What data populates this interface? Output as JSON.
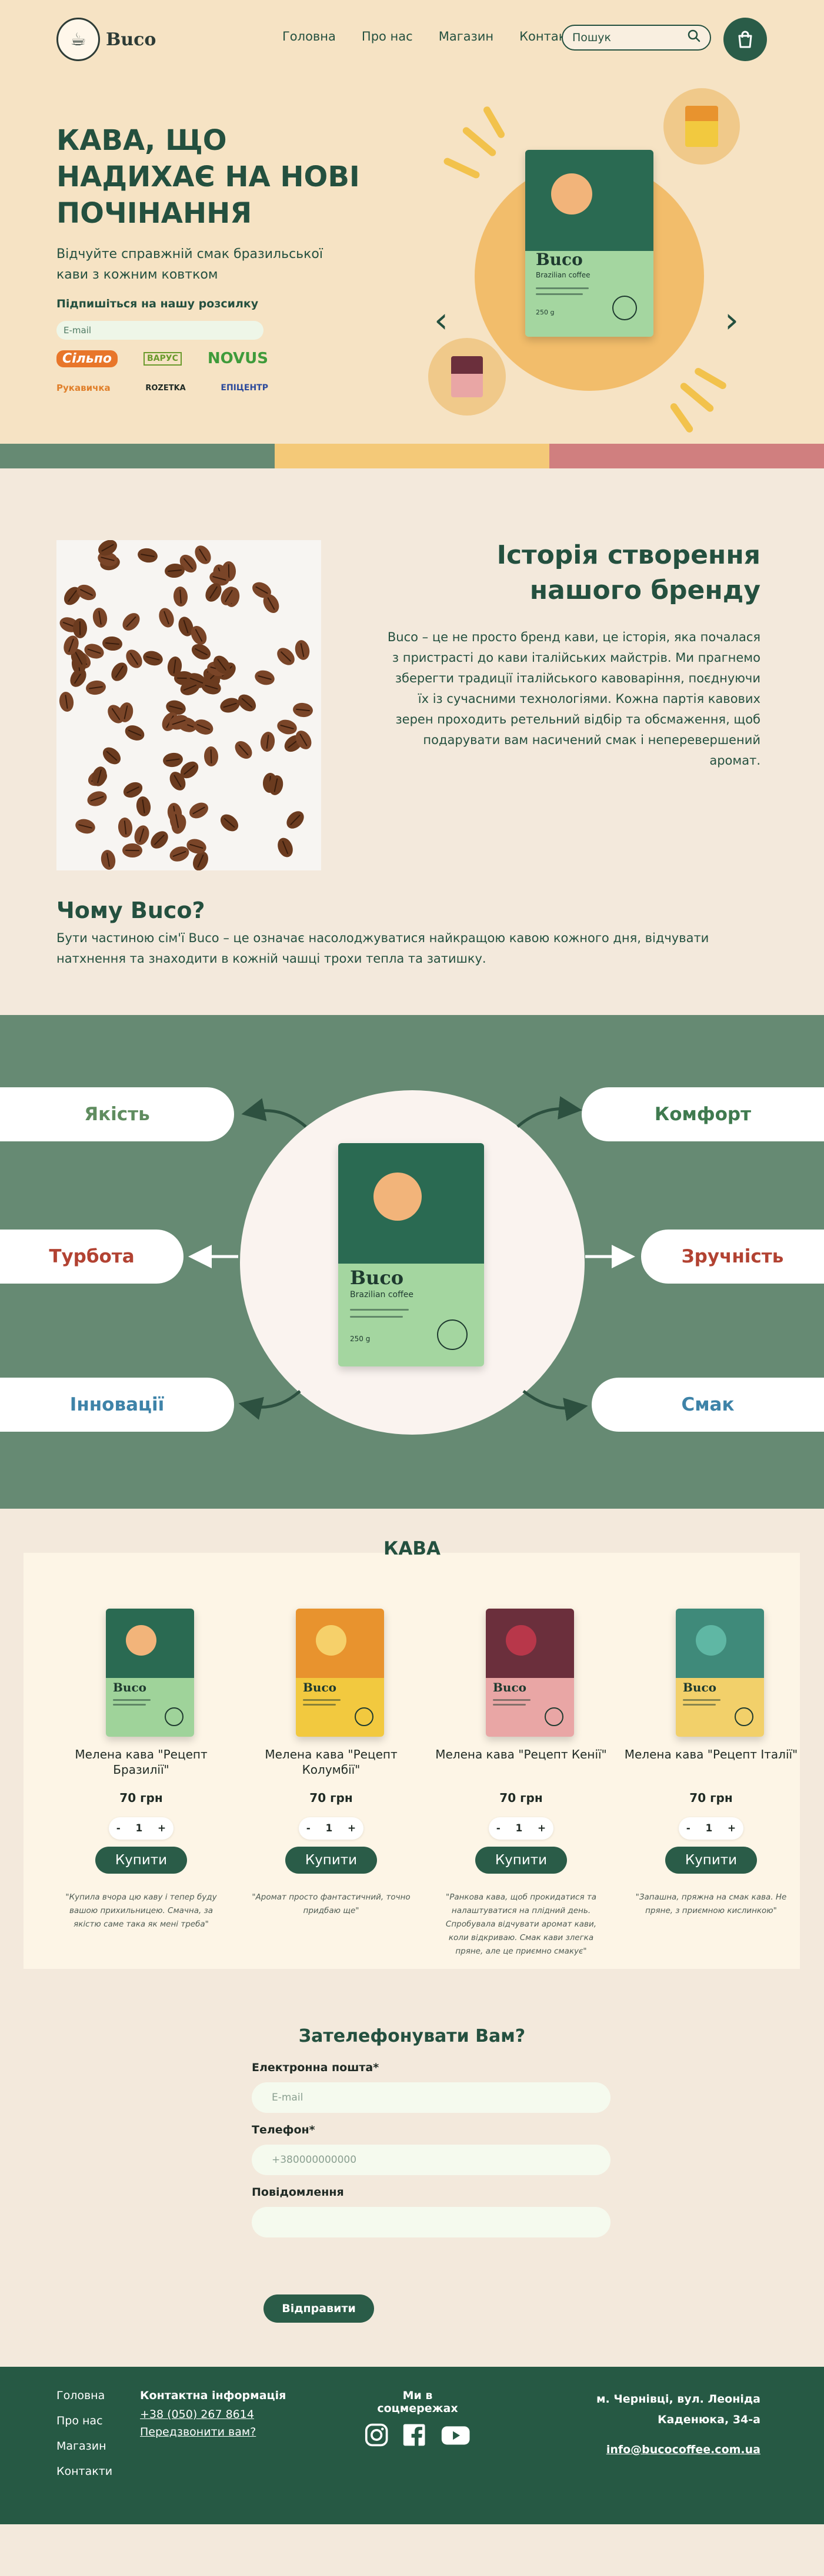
{
  "header": {
    "logo_text": "Buco",
    "nav": [
      "Головна",
      "Про нас",
      "Магазин",
      "Контакти"
    ],
    "search_placeholder": "Пошук"
  },
  "hero": {
    "title": "КАВА, ЩО НАДИХАЄ НА НОВІ ПОЧІНАННЯ",
    "subtitle": "Відчуйте справжній смак бразильської кави з кожним ковтком",
    "subscribe_label": "Підпишіться на нашу розсилку",
    "email_placeholder": "E-mail",
    "partners": [
      "Сільпо",
      "ВАРУС",
      "NOVUS",
      "Рукавичка",
      "ROZETKA",
      "ЕПІЦЕНТР"
    ],
    "bag_brand": "Buco",
    "bag_subtitle": "Brazilian coffee",
    "bag_weight": "250 g"
  },
  "history": {
    "title": "Історія створення нашого бренду",
    "text": "Buco – це не просто бренд кави, це історія, яка почалася з пристрасті до кави італійських майстрів. Ми прагнемо зберегти традиції італійського кавоваріння, поєднуючи їх із сучасними технологіями. Кожна партія кавових зерен проходить ретельний відбір та обсмаження, щоб подарувати вам насичений смак і неперевершений аромат.",
    "why_title": "Чому Buco?",
    "why_text": "Бути частиною сім'ї Buco – це означає насолоджуватися найкращою кавою кожного дня, відчувати натхнення та знаходити в кожній чашці трохи тепла та затишку."
  },
  "features": {
    "items": [
      "Якість",
      "Комфорт",
      "Турбота",
      "Зручність",
      "Інновації",
      "Смак"
    ]
  },
  "products": {
    "title": "КАВА",
    "buy_label": "Купити",
    "items": [
      {
        "name": "Мелена кава \"Рецепт Бразилії\"",
        "price": "70 грн",
        "qty": "1",
        "review": "\"Купила вчора цю каву і тепер буду вашою прихильницею. Смачна, за якістю саме така як мені треба\""
      },
      {
        "name": "Мелена кава \"Рецепт Колумбії\"",
        "price": "70 грн",
        "qty": "1",
        "review": "\"Аромат просто фантастичний, точно придбаю ще\""
      },
      {
        "name": "Мелена кава \"Рецепт Кенії\"",
        "price": "70 грн",
        "qty": "1",
        "review": "\"Ранкова кава, щоб прокидатися та налаштуватися на плідний день. Спробувала відчувати аромат кави, коли відкриваю. Смак кави злегка пряне, але це приємно смакує\""
      },
      {
        "name": "Мелена кава \"Рецепт Італії\"",
        "price": "70 грн",
        "qty": "1",
        "review": "\"Запашна, пряжна на смак кава. Не пряне, з приємною кислинкою\""
      }
    ],
    "colors": [
      {
        "top": "#2a6a52",
        "bot": "#9fd39a",
        "badge": "#f2b47a"
      },
      {
        "top": "#e8932e",
        "bot": "#f2c93f",
        "badge": "#f6d06a"
      },
      {
        "top": "#6b2f3c",
        "bot": "#e9a6a5",
        "badge": "#b8374a"
      },
      {
        "top": "#3f8a7a",
        "bot": "#f2d06a",
        "badge": "#5fb7a4"
      }
    ]
  },
  "callback": {
    "title": "Зателефонувати Вам?",
    "email_label": "Електронна пошта*",
    "email_placeholder": "E-mail",
    "phone_label": "Телефон*",
    "phone_placeholder": "+380000000000",
    "message_label": "Повідомлення",
    "submit": "Відправити"
  },
  "footer": {
    "links": [
      "Головна",
      "Про нас",
      "Магазин",
      "Контакти"
    ],
    "contact_heading": "Контактна інформація",
    "phone": "+38 (050) 267 8614",
    "call_us": "Передзвонити вам?",
    "social_heading": "Ми в соцмережах",
    "address_line1": "м. Чернівці, вул. Леоніда",
    "address_line2": "Каденюка, 34-а",
    "email": "info@bucocoffee.com.ua"
  },
  "colors": {
    "primary": "#24503f",
    "accent": "#f2bd6b",
    "stripe1": "#668a73",
    "stripe2": "#f4c978",
    "stripe3": "#d07f7f"
  }
}
